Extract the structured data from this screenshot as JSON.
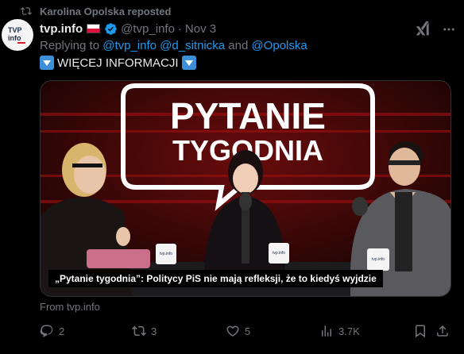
{
  "repost": {
    "icon": "repost-icon",
    "label": "Karolina Opolska reposted"
  },
  "author": {
    "avatar_text_top": "TVP",
    "avatar_text_bottom": "info",
    "name": "tvp.info",
    "flag": "poland-flag-icon",
    "verified_icon": "verified-badge-icon",
    "handle": "@tvp_info",
    "separator": "·",
    "date": "Nov 3"
  },
  "reply": {
    "prefix": "Replying to ",
    "to1": "@tvp_info",
    "to2": "@d_sitnicka",
    "and": " and ",
    "to3": "@Opolska"
  },
  "post": {
    "text": "WIĘCEJ INFORMACJI",
    "emoji_icon": "down-arrow-button-icon"
  },
  "media": {
    "title_line1": "PYTANIE",
    "title_line2": "TYGODNIA",
    "caption": "„Pytanie tygodnia”: Politycy PiS nie mają refleksji, że to kiedyś wyjdzie",
    "mug_label": "tvp.info"
  },
  "card": {
    "from": "From tvp.info"
  },
  "actions": {
    "replies": "2",
    "reposts": "3",
    "likes": "5",
    "views": "3.7K"
  },
  "colors": {
    "accent": "#1d9bf0",
    "muted": "#71767b",
    "text": "#e7e9ea",
    "background": "#000000"
  }
}
